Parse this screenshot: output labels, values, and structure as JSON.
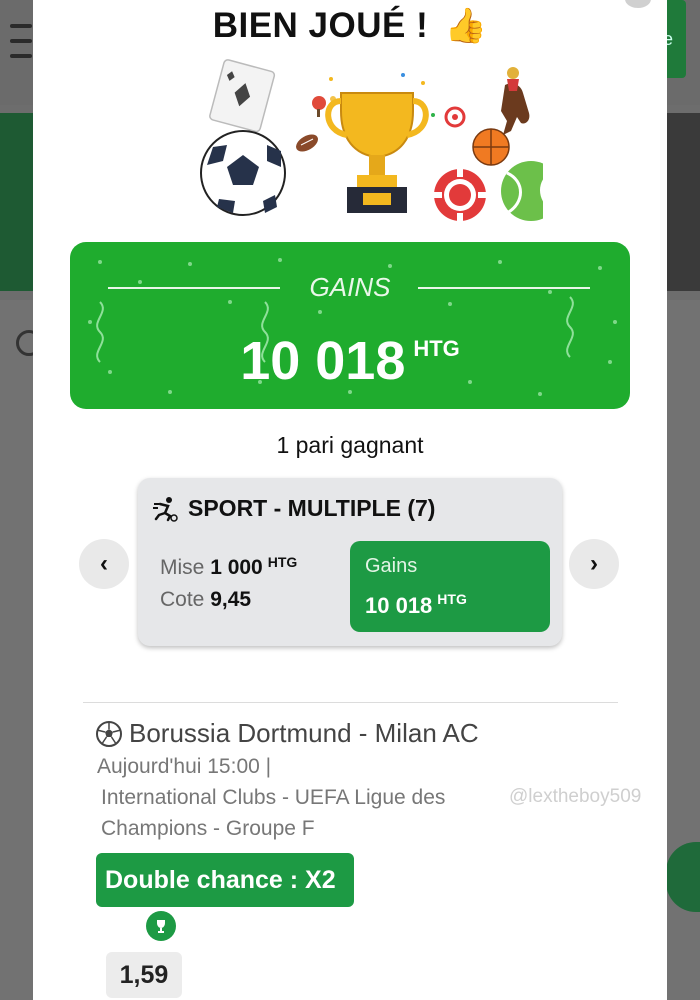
{
  "title": "BIEN JOUÉ !",
  "header_icon": "thumbs-up-icon",
  "gains_box": {
    "label": "GAINS",
    "amount": "10 018",
    "currency": "HTG"
  },
  "winning_count": "1 pari gagnant",
  "bet": {
    "title": "SPORT - MULTIPLE (7)",
    "stake_label": "Mise",
    "stake_value": "1 000",
    "stake_currency": "HTG",
    "odds_label": "Cote",
    "odds_value": "9,45",
    "gains_label": "Gains",
    "gains_value": "10 018",
    "gains_currency": "HTG"
  },
  "match": {
    "title": "Borussia Dortmund - Milan AC",
    "time": "Aujourd'hui 15:00 |",
    "competition_line1": "International Clubs  -  UEFA Ligue des",
    "competition_line2": "Champions  -  Groupe F",
    "selection": "Double chance : X2",
    "odds": "1,59"
  },
  "watermark": "@lextheboy509",
  "nav": {
    "prev_glyph": "‹",
    "next_glyph": "›"
  },
  "background": {
    "login_glyph": "e"
  },
  "colors": {
    "gains_green": "#1fac2e",
    "accent_green": "#1d9a44",
    "card_gray": "#e6e7e9"
  }
}
